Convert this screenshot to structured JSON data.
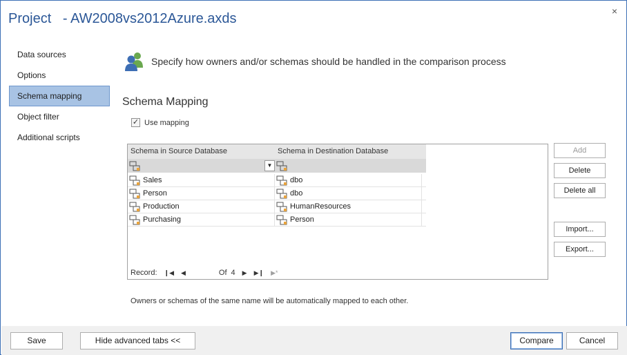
{
  "window": {
    "title": "Project   - AW2008vs2012Azure.axds",
    "close_glyph": "×"
  },
  "nav": {
    "items": [
      {
        "label": "Data sources",
        "active": false
      },
      {
        "label": "Options",
        "active": false
      },
      {
        "label": "Schema mapping",
        "active": true
      },
      {
        "label": "Object filter",
        "active": false
      },
      {
        "label": "Additional scripts",
        "active": false
      }
    ]
  },
  "header": {
    "icon": "users-icon",
    "text": "Specify how owners and/or schemas should be handled in the comparison process"
  },
  "section": {
    "title": "Schema Mapping",
    "use_mapping_label": "Use mapping",
    "use_mapping_checked": true
  },
  "grid": {
    "col_source": "Schema in Source Database",
    "col_dest": "Schema in Destination Database",
    "rows": [
      {
        "source": "Sales",
        "dest": "dbo"
      },
      {
        "source": "Person",
        "dest": "dbo"
      },
      {
        "source": "Production",
        "dest": "HumanResources"
      },
      {
        "source": "Purchasing",
        "dest": "Person"
      }
    ],
    "navigator": {
      "record_label": "Record:",
      "of_label": "Of",
      "count": "4"
    }
  },
  "side_buttons": {
    "add": "Add",
    "delete": "Delete",
    "delete_all": "Delete all",
    "import": "Import...",
    "export": "Export..."
  },
  "footnote": "Owners or schemas of the same name will be automatically mapped to each other.",
  "footer": {
    "save": "Save",
    "hide_tabs": "Hide advanced tabs <<",
    "compare": "Compare",
    "cancel": "Cancel"
  },
  "colors": {
    "accent": "#2b5797",
    "nav_active": "#a8c3e4",
    "footer_bg": "#f0f0f0"
  }
}
